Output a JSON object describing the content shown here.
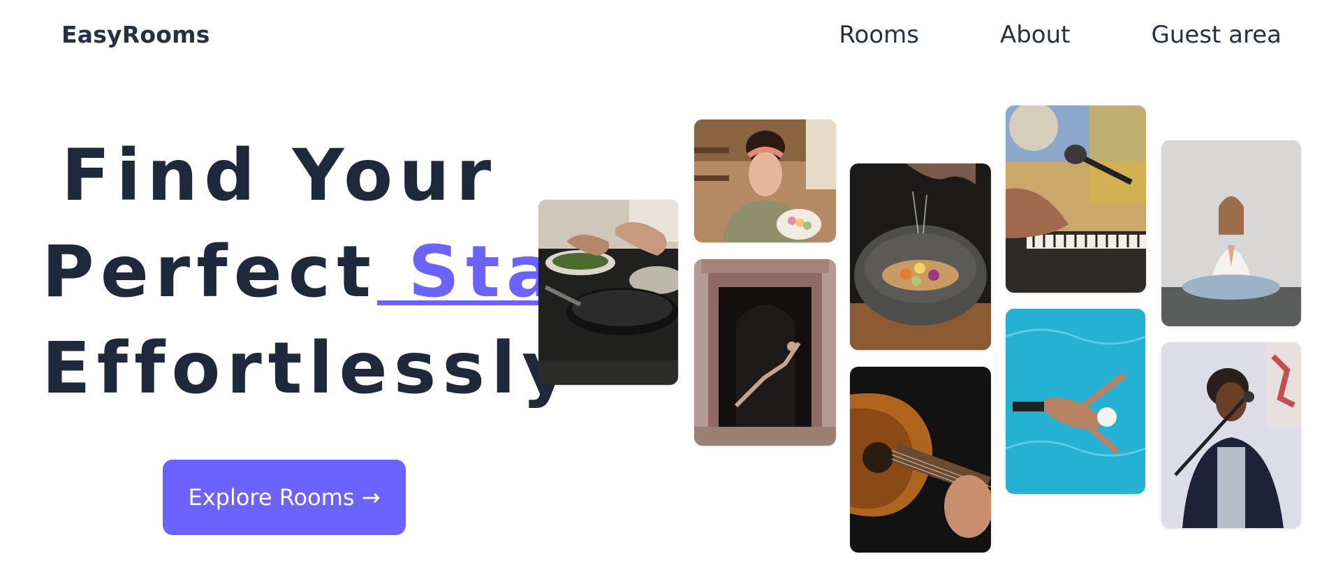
{
  "header": {
    "brand": "EasyRooms",
    "nav": [
      "Rooms",
      "About",
      "Guest area"
    ]
  },
  "hero": {
    "title_line1": "Find Your",
    "title_line2_pre": "Perfect",
    "title_line2_accent": " Stay",
    "title_line2_post": ",",
    "title_line3": "Effortlessly",
    "cta_label": "Explore Rooms →"
  },
  "colors": {
    "accent": "#6c63ff",
    "text": "#1e293b"
  },
  "gallery": {
    "images": [
      "cooking-pan-photo",
      "woman-with-macarons-photo",
      "dancer-in-doorway-photo",
      "spice-bowl-photo",
      "acoustic-guitar-photo",
      "piano-microphone-photo",
      "swimmer-in-pool-photo",
      "meditation-yoga-photo",
      "singer-with-microphone-photo"
    ]
  }
}
